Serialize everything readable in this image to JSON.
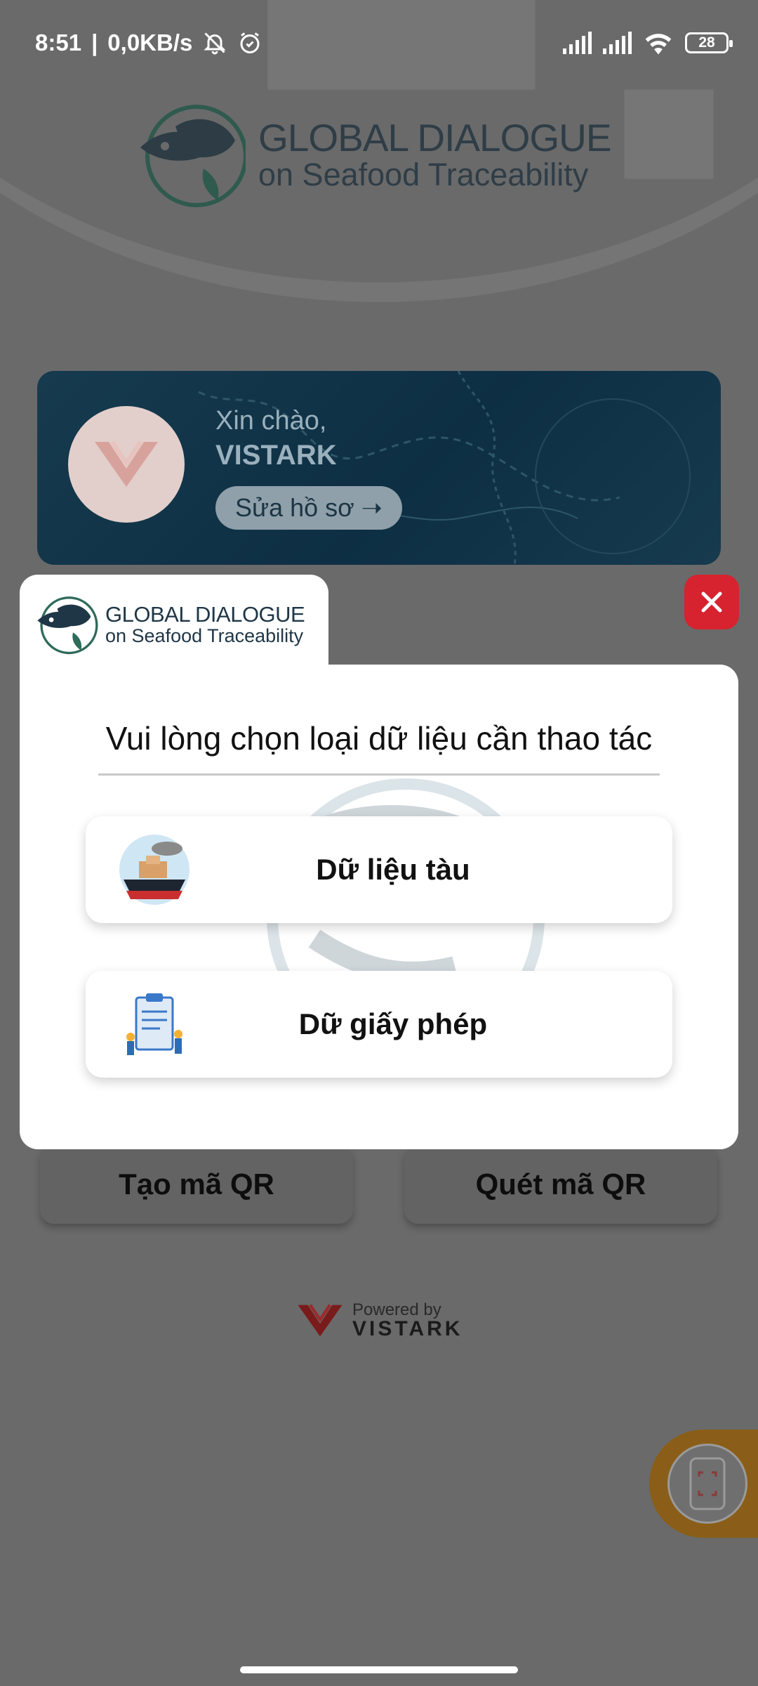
{
  "status_bar": {
    "time": "8:51",
    "separator": "|",
    "net_speed": "0,0KB/s",
    "battery": "28",
    "icons": [
      "mute-bell-icon",
      "alarm-icon",
      "signal-icon",
      "signal-icon",
      "wifi-icon",
      "battery-icon"
    ]
  },
  "header": {
    "brand_line1": "GLOBAL DIALOGUE",
    "brand_line2": "on Seafood Traceability"
  },
  "banner": {
    "greeting": "Xin chào,",
    "username": "VISTARK",
    "edit_label": "Sửa hồ sơ ➝"
  },
  "actions": {
    "create_qr": "Tạo mã QR",
    "scan_qr": "Quét mã QR"
  },
  "footer": {
    "powered_by": "Powered by",
    "company": "VISTARK"
  },
  "modal": {
    "brand_line1": "GLOBAL DIALOGUE",
    "brand_line2": "on Seafood Traceability",
    "title": "Vui lòng chọn loại dữ liệu cần thao tác",
    "options": [
      {
        "label": "Dữ liệu tàu",
        "icon": "ship-icon"
      },
      {
        "label": "Dữ giấy phép",
        "icon": "license-icon"
      }
    ],
    "close_icon": "close-icon"
  },
  "colors": {
    "overlay": "#6a6a6a",
    "close_red": "#d6232f",
    "fab_orange": "#8a5e18",
    "brand_dark": "#2f3d47"
  }
}
